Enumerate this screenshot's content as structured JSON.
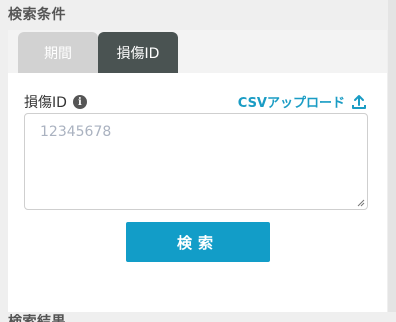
{
  "section_title": "検索条件",
  "tabs": [
    {
      "label": "期間",
      "active": false
    },
    {
      "label": "損傷ID",
      "active": true
    }
  ],
  "field": {
    "label": "損傷ID",
    "info_icon": "info-icon",
    "placeholder": "12345678"
  },
  "csv_upload": {
    "label": "CSVアップロード",
    "icon": "upload-icon"
  },
  "search_button": {
    "label": "検索"
  },
  "next_section_title": "検索結果",
  "colors": {
    "accent": "#129dc8",
    "link": "#1a9cc4",
    "active_tab": "#4a5352",
    "inactive_tab": "#d2d2d2"
  }
}
